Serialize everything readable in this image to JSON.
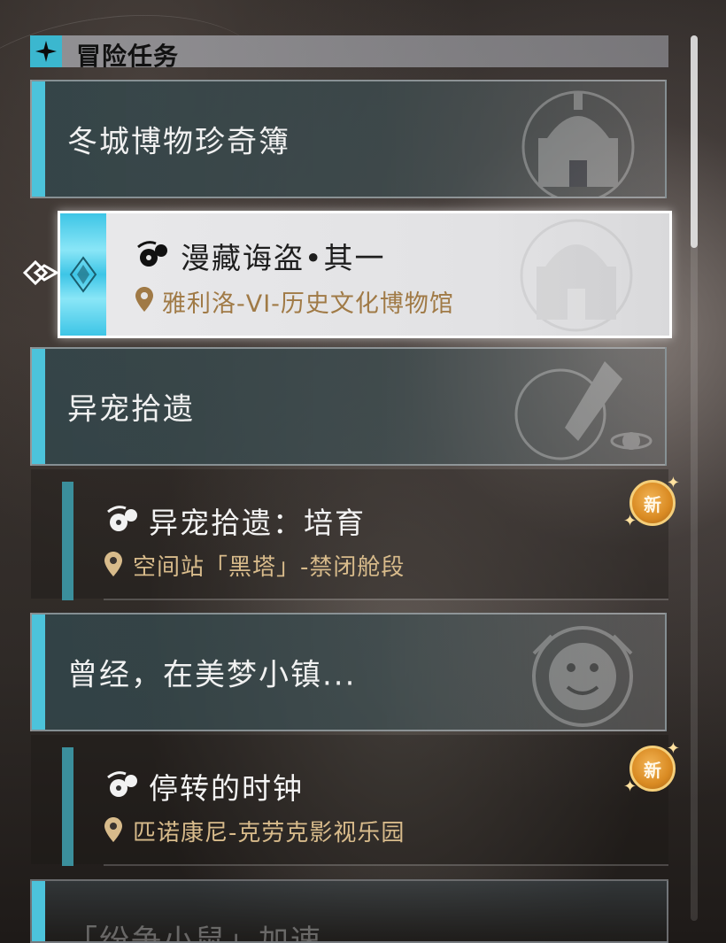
{
  "section": {
    "title": "冒险任务",
    "icon": "diamond-star-icon"
  },
  "categories": [
    {
      "title": "冬城博物珍奇簿",
      "emblem": "museum-emblem"
    },
    {
      "title": "异宠拾遗",
      "emblem": "rocket-planet-emblem"
    },
    {
      "title": "曾经，在美梦小镇...",
      "emblem": "smiley-clock-emblem"
    },
    {
      "title": "「纷争小鼠」加速",
      "emblem": "crystal-emblem"
    }
  ],
  "quests": [
    {
      "title": "漫藏诲盗•其一",
      "location": "雅利洛-VI-历史文化博物馆",
      "active": true
    },
    {
      "title": "异宠拾遗：培育",
      "location": "空间站「黑塔」-禁闭舱段",
      "badge": "新"
    },
    {
      "title": "停转的时钟",
      "location": "匹诺康尼-克劳克影视乐园",
      "badge": "新"
    }
  ],
  "colors": {
    "accent": "#4cc3db",
    "location_gold": "#d8bb8b",
    "badge": "#e09a2e"
  }
}
